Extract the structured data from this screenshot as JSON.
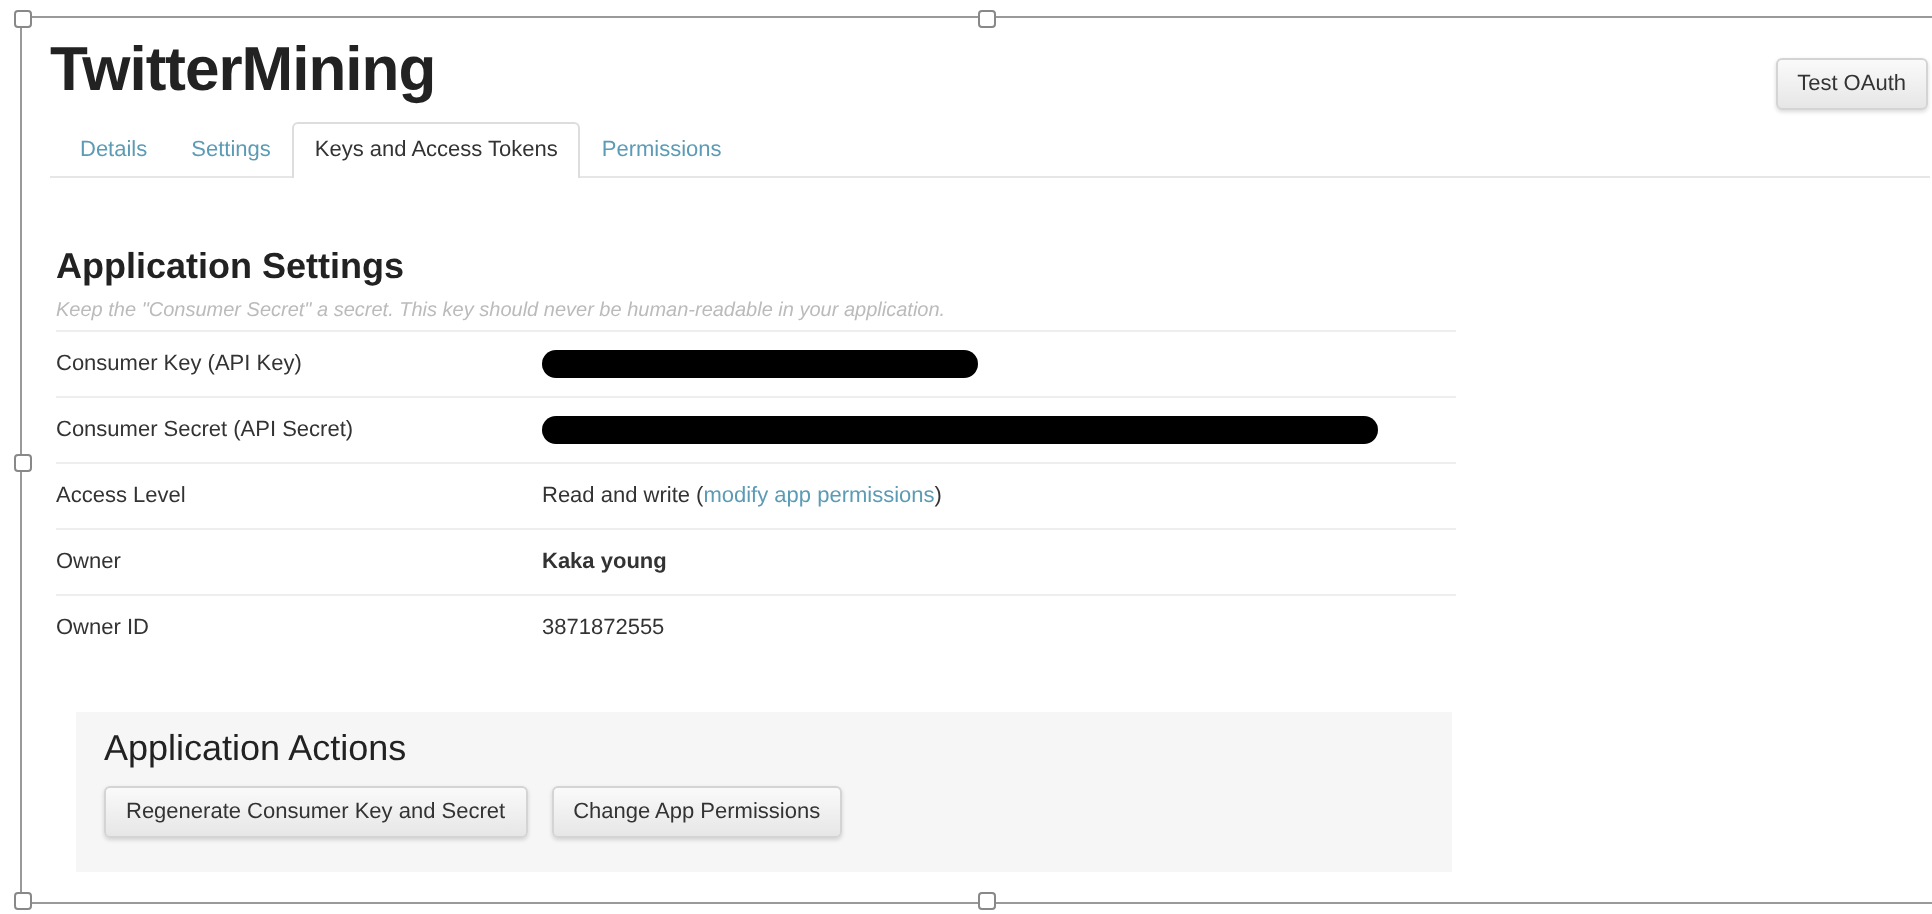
{
  "app": {
    "title": "TwitterMining",
    "test_button": "Test OAuth"
  },
  "tabs": [
    {
      "label": "Details",
      "selected": false
    },
    {
      "label": "Settings",
      "selected": false
    },
    {
      "label": "Keys and Access Tokens",
      "selected": true
    },
    {
      "label": "Permissions",
      "selected": false
    }
  ],
  "settings": {
    "heading": "Application Settings",
    "hint": "Keep the \"Consumer Secret\" a secret. This key should never be human-readable in your application.",
    "rows": [
      {
        "label": "Consumer Key (API Key)",
        "kind": "redacted-short"
      },
      {
        "label": "Consumer Secret (API Secret)",
        "kind": "redacted-long"
      },
      {
        "label": "Access Level",
        "kind": "link",
        "value": "Read and write (",
        "link": "modify app permissions",
        "after": ")"
      },
      {
        "label": "Owner",
        "kind": "bold",
        "value": "Kaka young"
      },
      {
        "label": "Owner ID",
        "kind": "text",
        "value": "3871872555"
      }
    ]
  },
  "actions": {
    "heading": "Application Actions",
    "buttons": [
      "Regenerate Consumer Key and Secret",
      "Change App Permissions"
    ]
  }
}
